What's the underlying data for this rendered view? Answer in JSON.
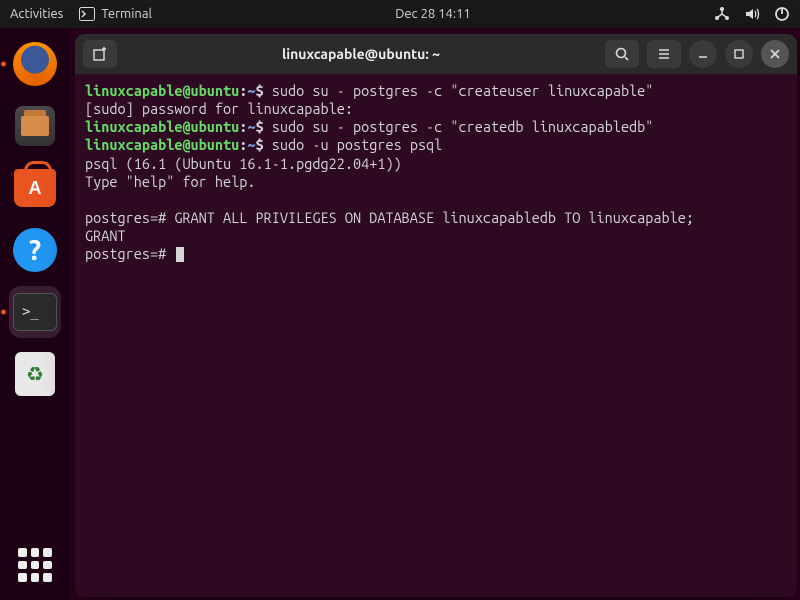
{
  "topbar": {
    "activities": "Activities",
    "app_name": "Terminal",
    "datetime": "Dec 28  14:11"
  },
  "window": {
    "title": "linuxcapable@ubuntu: ~"
  },
  "terminal": {
    "prompt_user_host": "linuxcapable@ubuntu",
    "prompt_path": "~",
    "prompt_symbol": "$",
    "lines": [
      {
        "type": "cmd",
        "text": "sudo su - postgres -c \"createuser linuxcapable\""
      },
      {
        "type": "out",
        "text": "[sudo] password for linuxcapable:"
      },
      {
        "type": "cmd",
        "text": "sudo su - postgres -c \"createdb linuxcapabledb\""
      },
      {
        "type": "cmd",
        "text": "sudo -u postgres psql"
      },
      {
        "type": "out",
        "text": "psql (16.1 (Ubuntu 16.1-1.pgdg22.04+1))"
      },
      {
        "type": "out",
        "text": "Type \"help\" for help."
      },
      {
        "type": "out",
        "text": ""
      },
      {
        "type": "psql",
        "prompt": "postgres=#",
        "text": "GRANT ALL PRIVILEGES ON DATABASE linuxcapabledb TO linuxcapable;"
      },
      {
        "type": "out",
        "text": "GRANT"
      },
      {
        "type": "psql",
        "prompt": "postgres=#",
        "text": "",
        "cursor": true
      }
    ]
  },
  "dock": {
    "items": [
      {
        "name": "firefox",
        "label": "Firefox"
      },
      {
        "name": "files",
        "label": "Files"
      },
      {
        "name": "software",
        "label": "Ubuntu Software"
      },
      {
        "name": "help",
        "label": "Help"
      },
      {
        "name": "terminal",
        "label": "Terminal",
        "active": true
      },
      {
        "name": "trash",
        "label": "Trash"
      }
    ],
    "apps_label": "Show Applications"
  }
}
